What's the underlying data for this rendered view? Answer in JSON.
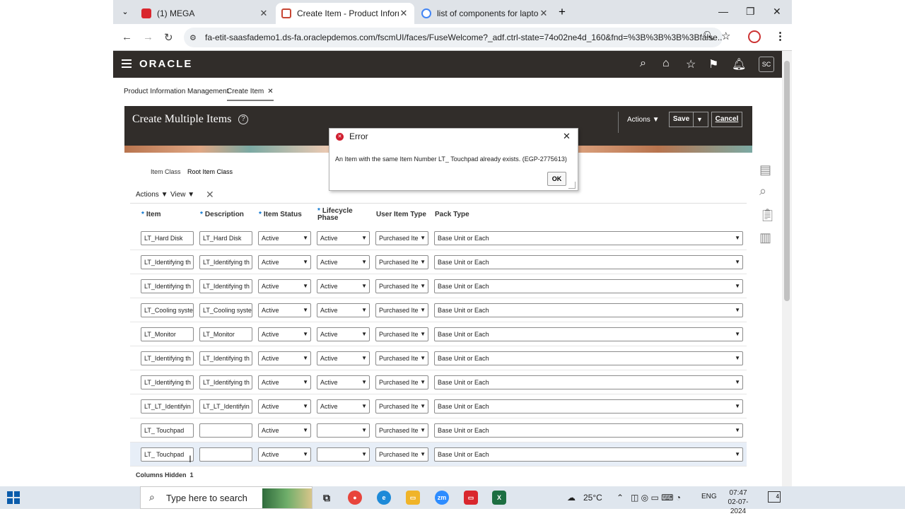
{
  "browser": {
    "tabs": [
      {
        "title": "(1) MEGA"
      },
      {
        "title": "Create Item - Product Informati"
      },
      {
        "title": "list of components for laptop -"
      }
    ],
    "url": "fa-etit-saasfademo1.ds-fa.oraclepdemos.com/fscmUI/faces/FuseWelcome?_adf.ctrl-state=74o02ne4d_160&fnd=%3B%3B%3B%3Bfalse..."
  },
  "oracle": {
    "logo": "ORACLE",
    "avatar": "SC"
  },
  "breadcrumbs": {
    "pim": "Product Information Management",
    "create": "Create Item"
  },
  "panel": {
    "title": "Create Multiple Items",
    "actions": "Actions",
    "save": "Save",
    "cancel": "Cancel",
    "item_class_label": "Item Class",
    "item_class_value": "Root Item Class"
  },
  "toolbar": {
    "actions": "Actions",
    "view": "View"
  },
  "table": {
    "headers": {
      "item": "Item",
      "description": "Description",
      "item_status": "Item Status",
      "lifecycle_line1": "Lifecycle",
      "lifecycle_line2": "Phase",
      "user_item_type": "User Item Type",
      "pack_type": "Pack Type"
    },
    "rows": [
      {
        "item": "LT_Hard Disk",
        "description": "LT_Hard Disk",
        "status": "Active",
        "phase": "Active",
        "type": "Purchased Ite",
        "pack": "Base Unit or Each"
      },
      {
        "item": "LT_Identifying th",
        "description": "LT_Identifying th",
        "status": "Active",
        "phase": "Active",
        "type": "Purchased Ite",
        "pack": "Base Unit or Each"
      },
      {
        "item": "LT_Identifying th",
        "description": "LT_Identifying th",
        "status": "Active",
        "phase": "Active",
        "type": "Purchased Ite",
        "pack": "Base Unit or Each"
      },
      {
        "item": "LT_Cooling syste",
        "description": "LT_Cooling syste",
        "status": "Active",
        "phase": "Active",
        "type": "Purchased Ite",
        "pack": "Base Unit or Each"
      },
      {
        "item": "LT_Monitor",
        "description": "LT_Monitor",
        "status": "Active",
        "phase": "Active",
        "type": "Purchased Ite",
        "pack": "Base Unit or Each"
      },
      {
        "item": "LT_Identifying th",
        "description": "LT_Identifying th",
        "status": "Active",
        "phase": "Active",
        "type": "Purchased Ite",
        "pack": "Base Unit or Each"
      },
      {
        "item": "LT_Identifying th",
        "description": "LT_Identifying th",
        "status": "Active",
        "phase": "Active",
        "type": "Purchased Ite",
        "pack": "Base Unit or Each"
      },
      {
        "item": "LT_LT_Identifyin",
        "description": "LT_LT_Identifyin",
        "status": "Active",
        "phase": "Active",
        "type": "Purchased Ite",
        "pack": "Base Unit or Each"
      },
      {
        "item": "LT_ Touchpad",
        "description": "",
        "status": "Active",
        "phase": "",
        "type": "Purchased Ite",
        "pack": "Base Unit or Each"
      },
      {
        "item": "LT_ Touchpad",
        "description": "",
        "status": "Active",
        "phase": "",
        "type": "Purchased Ite",
        "pack": "Base Unit or Each"
      }
    ],
    "columns_hidden_label": "Columns Hidden",
    "columns_hidden_count": "1"
  },
  "dialog": {
    "title": "Error",
    "message": "An Item with the same Item Number LT_ Touchpad already exists. (EGP-2775613)",
    "ok": "OK"
  },
  "taskbar": {
    "search_placeholder": "Type here to search",
    "temperature": "25°C",
    "language": "ENG",
    "time": "07:47",
    "date": "02-07-2024",
    "notifications": "4"
  },
  "colors": {
    "oracle_header": "#312d2a",
    "error_red": "#d01e2f",
    "required_blue": "#0572ce"
  }
}
